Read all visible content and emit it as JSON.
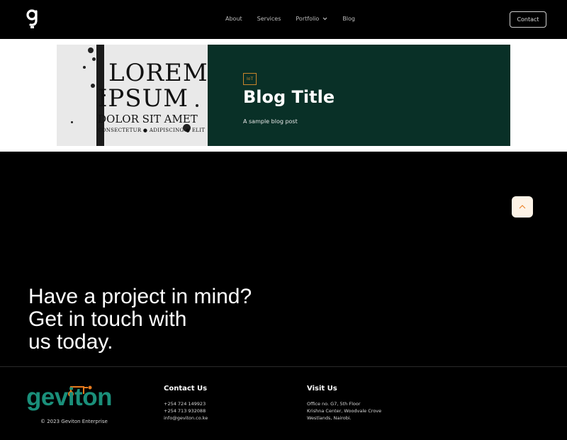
{
  "nav": {
    "logo_icon": "geviton-g-logo-icon",
    "links": [
      {
        "label": "About"
      },
      {
        "label": "Services"
      },
      {
        "label": "Portfolio",
        "icon": "chevron-down-icon"
      },
      {
        "label": "Blog"
      }
    ],
    "contact_label": "Contact"
  },
  "blog_card": {
    "image_text": {
      "line1": "LOREM",
      "line2": "IPSUM",
      "line3": "DOLOR SIT AMET",
      "line4": "CONSECTETUR ● ADIPISCING ● ELIT"
    },
    "tag": "IoT",
    "title": "Blog Title",
    "subtitle": "A sample blog post"
  },
  "scroll_top": {
    "icon": "chevron-up-icon"
  },
  "cta": {
    "line1": "Have a project in mind?",
    "line2": "Get in touch with",
    "line3": "us today."
  },
  "footer": {
    "brand": "geviton",
    "copyright": "© 2023 Geviton Enterprise",
    "contact": {
      "title": "Contact Us",
      "lines": [
        "+254 724 149923",
        "+254 713 932088",
        "info@geviton.co.ke"
      ]
    },
    "visit": {
      "title": "Visit Us",
      "lines": [
        "Office no. G7, 5th Floor",
        "Krishna Center, Woodvale Crove",
        "Westlands, Nairobi."
      ]
    }
  },
  "colors": {
    "card_green": "#093027",
    "accent_orange": "#e87b1e",
    "brand_teal": "#1a8f7a",
    "tag_border": "#c9852b"
  }
}
